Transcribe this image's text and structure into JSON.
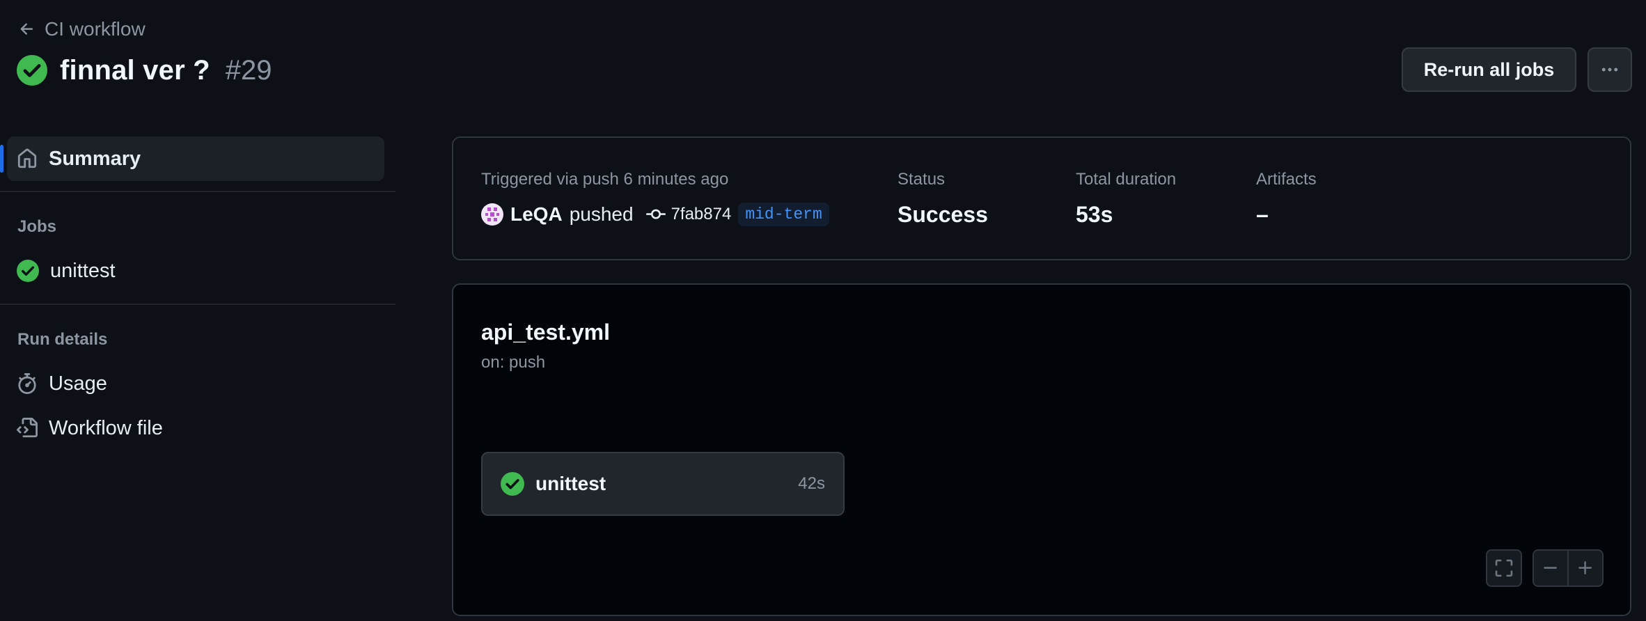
{
  "header": {
    "back_label": "CI workflow",
    "run_title": "finnal ver ?",
    "run_number": "#29",
    "rerun_label": "Re-run all jobs"
  },
  "sidebar": {
    "summary_label": "Summary",
    "jobs_heading": "Jobs",
    "jobs": [
      {
        "label": "unittest",
        "status": "success"
      }
    ],
    "run_details_heading": "Run details",
    "usage_label": "Usage",
    "workflow_file_label": "Workflow file"
  },
  "summary": {
    "trigger_text": "Triggered via push 6 minutes ago",
    "actor": "LeQA",
    "action": "pushed",
    "commit_sha": "7fab874",
    "branch": "mid-term",
    "status_label": "Status",
    "status_value": "Success",
    "duration_label": "Total duration",
    "duration_value": "53s",
    "artifacts_label": "Artifacts",
    "artifacts_value": "–"
  },
  "graph": {
    "workflow_file": "api_test.yml",
    "trigger": "on: push",
    "jobs": [
      {
        "name": "unittest",
        "duration": "42s",
        "status": "success"
      }
    ]
  },
  "icons": {
    "success": "check-circle-fill-icon",
    "back": "arrow-left-icon",
    "summary": "home-icon",
    "usage": "stopwatch-icon",
    "workflow_file": "file-code-icon",
    "commit": "git-commit-icon",
    "more": "kebab-horizontal-icon",
    "fullscreen": "screen-full-icon",
    "zoom_out": "dash-icon",
    "zoom_in": "plus-icon"
  },
  "colors": {
    "background": "#0d1117",
    "success": "#3fb950",
    "accent": "#1f6feb",
    "branch_text": "#4493f8",
    "muted_text": "#8d96a0"
  }
}
